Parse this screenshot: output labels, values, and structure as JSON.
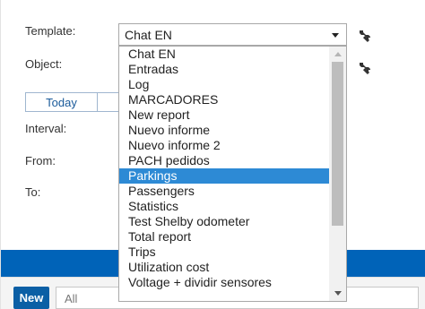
{
  "form": {
    "template_label": "Template:",
    "object_label": "Object:",
    "interval_label": "Interval:",
    "from_label": "From:",
    "to_label": "To:",
    "template_value": "Chat EN"
  },
  "tabs": {
    "today_label": "Today"
  },
  "dropdown": {
    "items": [
      "Chat EN",
      "Entradas",
      "Log",
      "MARCADORES",
      "New report",
      "Nuevo informe",
      "Nuevo informe 2",
      "PACH pedidos",
      "Parkings",
      "Passengers",
      "Statistics",
      "Test Shelby odometer",
      "Total report",
      "Trips",
      "Utilization cost",
      "Voltage + dividir sensores"
    ],
    "highlighted": "Parkings"
  },
  "footer": {
    "new_label": "New",
    "filter_value": "All"
  },
  "icons": {
    "template_settings": "wrench-icon",
    "object_settings": "wrench-icon"
  },
  "colors": {
    "accent": "#0063b8",
    "selection": "#2d8ad5",
    "new_button": "#0b5fa5"
  }
}
